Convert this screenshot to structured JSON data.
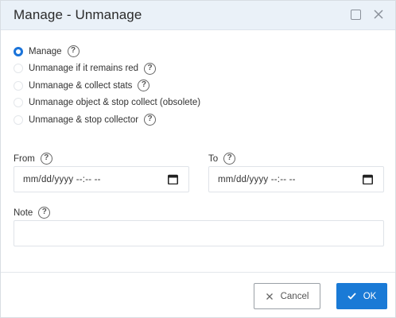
{
  "dialog": {
    "title": "Manage - Unmanage"
  },
  "options": [
    {
      "label": "Manage",
      "checked": true
    },
    {
      "label": "Unmanage if it remains red",
      "checked": false
    },
    {
      "label": "Unmanage & collect stats",
      "checked": false
    },
    {
      "label": "Unmanage object & stop collect (obsolete)",
      "checked": false
    },
    {
      "label": "Unmanage & stop collector",
      "checked": false
    }
  ],
  "from": {
    "label": "From",
    "placeholder": "mm/dd/yyyy --:-- --"
  },
  "to": {
    "label": "To",
    "placeholder": "mm/dd/yyyy --:-- --"
  },
  "note": {
    "label": "Note",
    "value": ""
  },
  "help_glyph": "?",
  "buttons": {
    "cancel": "Cancel",
    "ok": "OK"
  },
  "colors": {
    "accent": "#1a7ad6",
    "header_bg": "#eaf1f8"
  },
  "icons": {
    "maximize": "maximize-icon",
    "close": "close-icon",
    "help": "help-icon",
    "calendar": "calendar-icon",
    "check": "check-icon",
    "cancel": "x-icon"
  }
}
